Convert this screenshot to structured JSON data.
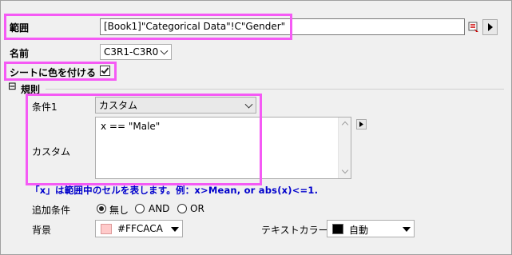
{
  "range": {
    "label": "範囲",
    "value": "[Book1]\"Categorical Data\"!C\"Gender\""
  },
  "name": {
    "label": "名前",
    "value": "C3R1-C3R0"
  },
  "color_sheet": {
    "label": "シートに色を付ける",
    "checked": true
  },
  "rules": {
    "toggle": "⊟",
    "label": "規則",
    "condition_label": "条件1",
    "condition_value": "カスタム",
    "custom_label": "カスタム",
    "custom_expression": "x == \"Male\"",
    "hint": "「x」は範囲中のセルを表します。例：x>Mean, or abs(x)<=1.",
    "additional_label": "追加条件",
    "options": [
      "無し",
      "AND",
      "OR"
    ],
    "selected_option": "無し"
  },
  "background": {
    "label": "背景",
    "color_name": "#FFCACA",
    "color": "#FFCACA"
  },
  "text_color": {
    "label": "テキストカラー",
    "value": "自動",
    "color": "#000000"
  },
  "highlight_color": "#F55AF5",
  "hint_color": "#0000CC"
}
